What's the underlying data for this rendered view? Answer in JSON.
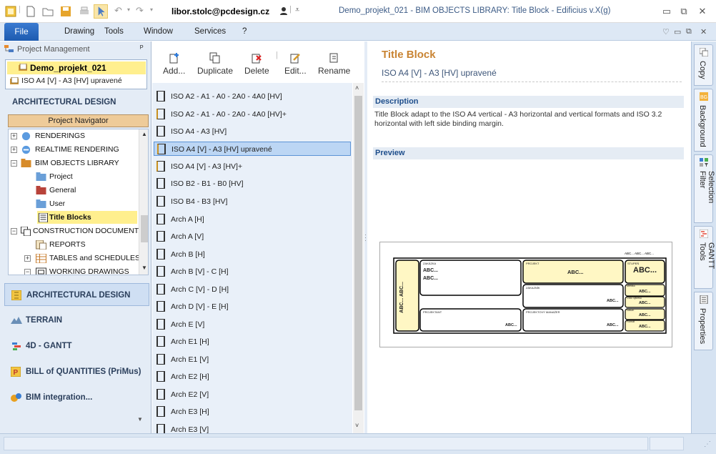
{
  "titlebar": {
    "user": "libor.stolc@pcdesign.cz",
    "title": "Demo_projekt_021 -  BIM OBJECTS LIBRARY: Title Block - Edificius v.X(g)",
    "minimize": "▭",
    "restore": "⧉",
    "close": "✕"
  },
  "menubar": {
    "file": "File",
    "items": [
      "Drawing",
      "Tools",
      "Window",
      "Services",
      "?"
    ],
    "mdi": [
      "♡",
      "▭",
      "⧉",
      "✕"
    ]
  },
  "project_management": {
    "header": "Project Management",
    "pin": "ᴾ",
    "project": "Demo_projekt_021",
    "item": "ISO  A4 [V] - A3 [HV] upravené"
  },
  "left": {
    "section_title": "ARCHITECTURAL DESIGN",
    "navigator": "Project Navigator",
    "tree": [
      {
        "label": "RENDERINGS",
        "exp": "+"
      },
      {
        "label": "REALTIME RENDERING",
        "exp": "+"
      },
      {
        "label": "BIM OBJECTS LIBRARY",
        "exp": "−"
      },
      {
        "label": "Project",
        "exp": ""
      },
      {
        "label": "General",
        "exp": ""
      },
      {
        "label": "User",
        "exp": ""
      },
      {
        "label": "Title Blocks",
        "exp": ""
      },
      {
        "label": "CONSTRUCTION DOCUMENT:",
        "exp": "−"
      },
      {
        "label": "REPORTS",
        "exp": ""
      },
      {
        "label": "TABLES and SCHEDULES",
        "exp": "+"
      },
      {
        "label": "WORKING DRAWINGS",
        "exp": "−"
      }
    ],
    "nav_buttons": [
      "ARCHITECTURAL DESIGN",
      "TERRAIN",
      "4D - GANTT",
      "BILL of QUANTITIES (PriMus)",
      "BIM integration..."
    ]
  },
  "toolbar": {
    "add": "Add...",
    "duplicate": "Duplicate",
    "delete": "Delete",
    "edit": "Edit...",
    "rename": "Rename"
  },
  "list": [
    "ISO  A2 - A1 - A0 - 2A0 - 4A0 [HV]",
    "ISO  A2 - A1 - A0 - 2A0 - 4A0 [HV]+",
    "ISO  A4 - A3 [HV]",
    "ISO  A4 [V] - A3 [HV] upravené",
    "ISO  A4 [V] - A3 [HV]+",
    "ISO  B2 - B1 - B0 [HV]",
    "ISO  B4 - B3 [HV]",
    "Arch  A [H]",
    "Arch  A [V]",
    "Arch  B [H]",
    "Arch  B [V] - C [H]",
    "Arch  C [V] - D [H]",
    "Arch  D [V] - E [H]",
    "Arch  E [V]",
    "Arch  E1 [H]",
    "Arch  E1 [V]",
    "Arch  E2 [H]",
    "Arch  E2 [V]",
    "Arch  E3 [H]",
    "Arch  E3 [V]"
  ],
  "detail": {
    "title": "Title Block",
    "subtitle": "ISO  A4 [V] - A3 [HV] upravené",
    "description_header": "Description",
    "description": "Title Block adapt to the ISO A4 vertical - A3 horizontal and vertical formats and ISO 3.2 horizontal with left side binding margin.",
    "preview_header": "Preview",
    "preview": {
      "top_right": "ABC...  ABC...  ABC...",
      "side": "ABC... ABC...",
      "zakazka_label": "ZAKÁZKA",
      "zakazka_a": "ABC...",
      "zakazka_b": "ABC...",
      "projekt_label": "PROJEKT",
      "projekt": "ABC...",
      "stupen_label": "STUPEŇ",
      "stupen": "ABC...",
      "zakaznik_label": "ZÁKAZNÍK",
      "zakaznik": "ABC...",
      "meritko_label": "Měřítko",
      "meritko": "ABC...",
      "cislo_label": "Číslo výkresu",
      "cislo": "ABC...",
      "datum_label": "Datum",
      "datum": "ABC...",
      "format_label": "Formát",
      "format": "ABC...",
      "projektant_label": "PROJEKTANT",
      "projektant": "ABC...",
      "manazer_label": "PROJEKTOVÝ MANAŽER",
      "manazer": "ABC..."
    }
  },
  "side_tabs": [
    "Copy",
    "Background",
    "Selection Filter",
    "GANTT Tools",
    "Properties"
  ],
  "status": {
    "grip": "⋰"
  }
}
